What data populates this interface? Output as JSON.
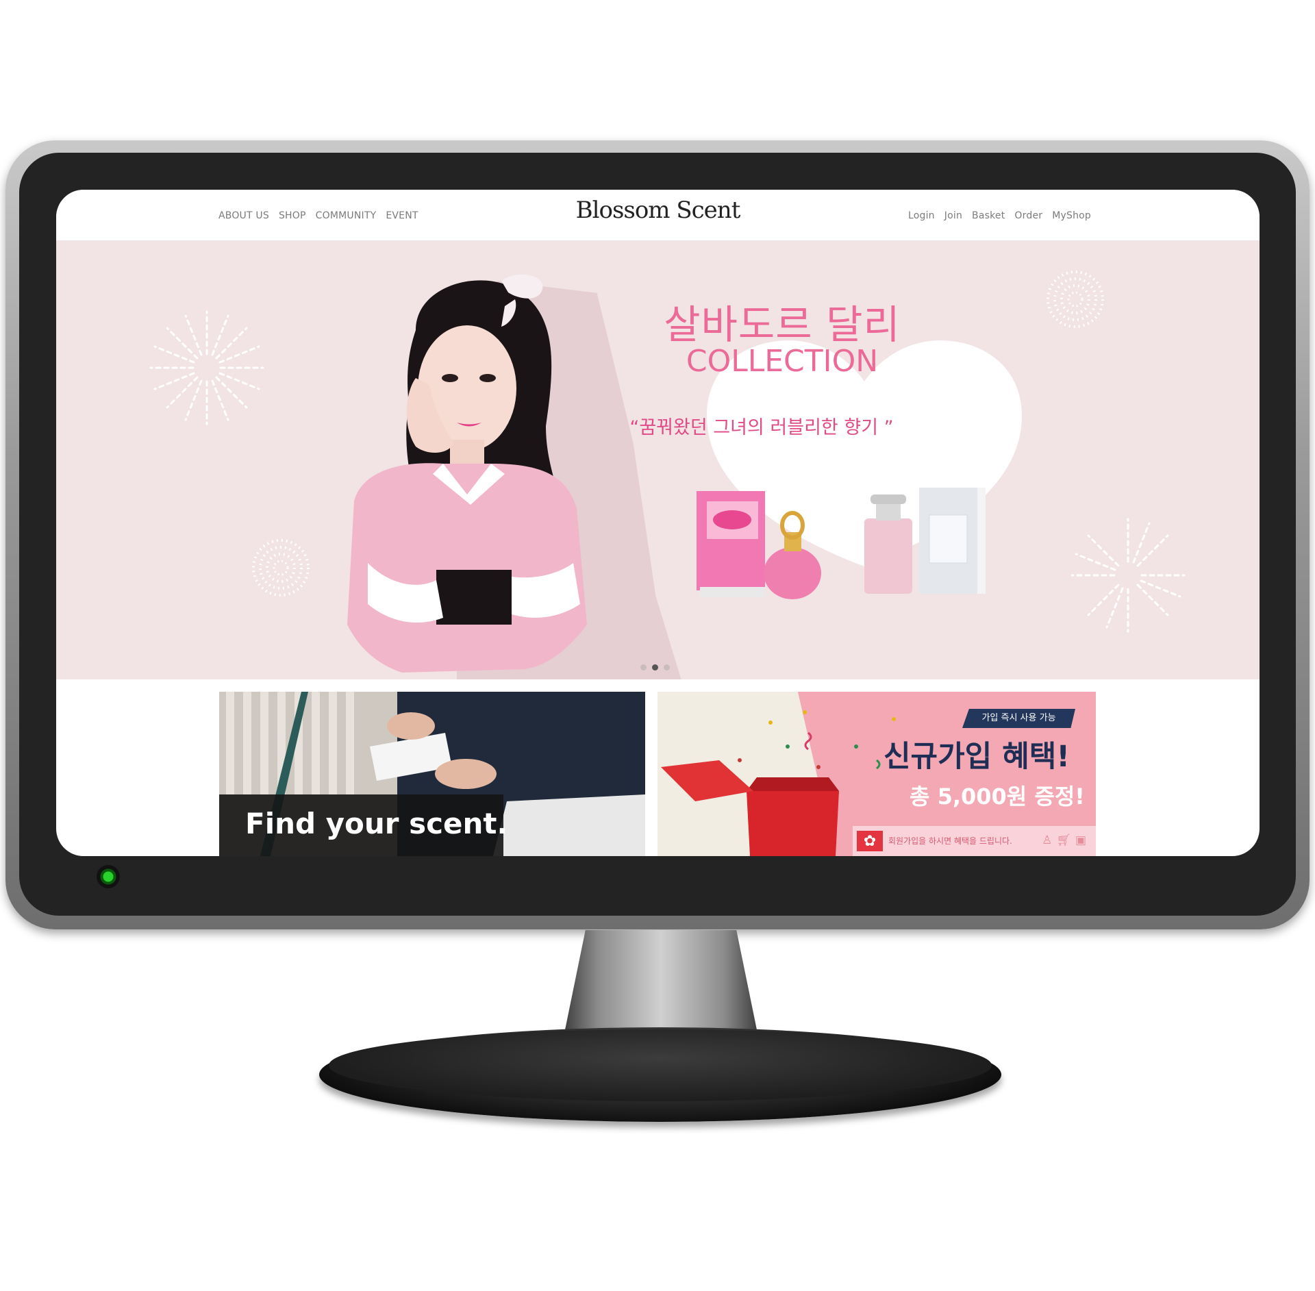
{
  "header": {
    "brand": "Blossom Scent",
    "nav_left": [
      "ABOUT US",
      "SHOP",
      "COMMUNITY",
      "EVENT"
    ],
    "nav_right": [
      "Login",
      "Join",
      "Basket",
      "Order",
      "MyShop"
    ]
  },
  "hero": {
    "title_kr": "살바도르 달리",
    "title_en": "COLLECTION",
    "quote": "“꿈꿔왔던 그녀의 러블리한 향기 ”",
    "slides_total": 3,
    "active_slide": 2
  },
  "banners": {
    "scent": {
      "text": "Find your scent."
    },
    "join": {
      "tag": "가입 즉시 사용 가능",
      "headline": "신규가입 혜택!",
      "subline": "총 5,000원 증정!",
      "footer": "회원가입을 하시면 혜택을 드립니다."
    }
  },
  "colors": {
    "hero_bg": "#f2e3e5",
    "accent_pink": "#ec6a98",
    "navy": "#1f2e55"
  }
}
